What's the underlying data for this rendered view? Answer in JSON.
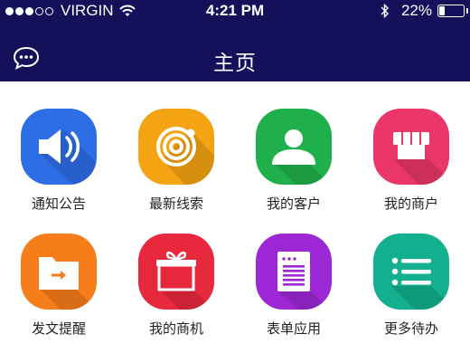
{
  "status_bar": {
    "signal_bars_filled": 3,
    "signal_bars_total": 5,
    "carrier": "VIRGIN",
    "time": "4:21 PM",
    "battery_percent": "22%",
    "battery_level": 0.22
  },
  "nav": {
    "title": "主页",
    "left_icon": "chat-bubble-icon"
  },
  "colors": {
    "header_bg": "#14105a"
  },
  "grid": {
    "items": [
      {
        "label": "通知公告",
        "icon": "speaker-icon",
        "color": "#2d6ee6"
      },
      {
        "label": "最新线索",
        "icon": "target-icon",
        "color": "#f4a312"
      },
      {
        "label": "我的客户",
        "icon": "customer-icon",
        "color": "#1fb04b"
      },
      {
        "label": "我的商户",
        "icon": "storefront-icon",
        "color": "#ea3668"
      },
      {
        "label": "发文提醒",
        "icon": "folder-send-icon",
        "color": "#f77d1b"
      },
      {
        "label": "我的商机",
        "icon": "gift-box-icon",
        "color": "#e8283d"
      },
      {
        "label": "表单应用",
        "icon": "form-icon",
        "color": "#9c27d4"
      },
      {
        "label": "更多待办",
        "icon": "todo-list-icon",
        "color": "#12b08e"
      }
    ]
  }
}
